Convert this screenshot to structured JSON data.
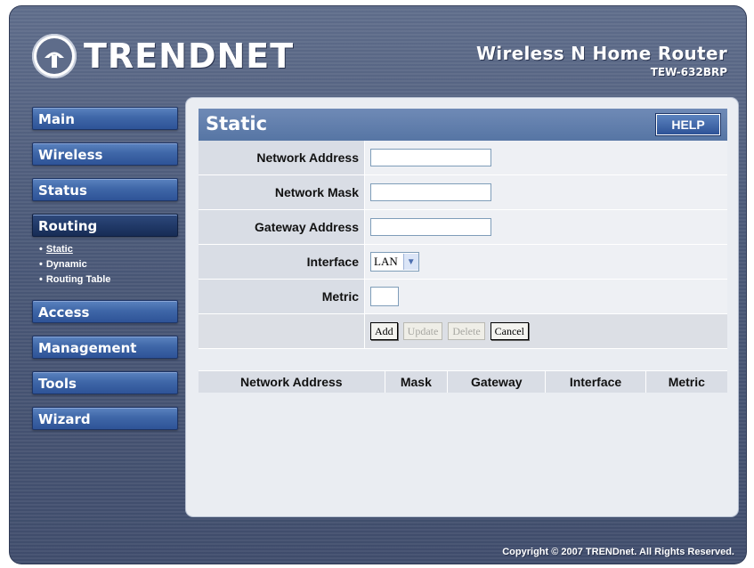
{
  "header": {
    "brand": "TRENDNET",
    "product_name": "Wireless N Home Router",
    "product_model": "TEW-632BRP"
  },
  "sidebar": {
    "items": [
      {
        "label": "Main"
      },
      {
        "label": "Wireless"
      },
      {
        "label": "Status"
      },
      {
        "label": "Routing"
      },
      {
        "label": "Access"
      },
      {
        "label": "Management"
      },
      {
        "label": "Tools"
      },
      {
        "label": "Wizard"
      }
    ],
    "routing_sub": [
      {
        "label": "Static"
      },
      {
        "label": "Dynamic"
      },
      {
        "label": "Routing Table"
      }
    ]
  },
  "panel": {
    "title": "Static",
    "help_label": "HELP",
    "fields": {
      "network_address": {
        "label": "Network Address",
        "value": ""
      },
      "network_mask": {
        "label": "Network Mask",
        "value": ""
      },
      "gateway_address": {
        "label": "Gateway Address",
        "value": ""
      },
      "interface": {
        "label": "Interface",
        "selected": "LAN"
      },
      "metric": {
        "label": "Metric",
        "value": ""
      }
    },
    "buttons": {
      "add": "Add",
      "update": "Update",
      "delete": "Delete",
      "cancel": "Cancel"
    },
    "table": {
      "headers": [
        "Network Address",
        "Mask",
        "Gateway",
        "Interface",
        "Metric"
      ],
      "rows": []
    }
  },
  "footer": {
    "copyright": "Copyright © 2007 TRENDnet. All Rights Reserved."
  },
  "colors": {
    "frame": "#4a5877",
    "nav_button": "#3f67a8",
    "panel_header": "#5675a4",
    "panel_bg": "#eaedf2"
  }
}
